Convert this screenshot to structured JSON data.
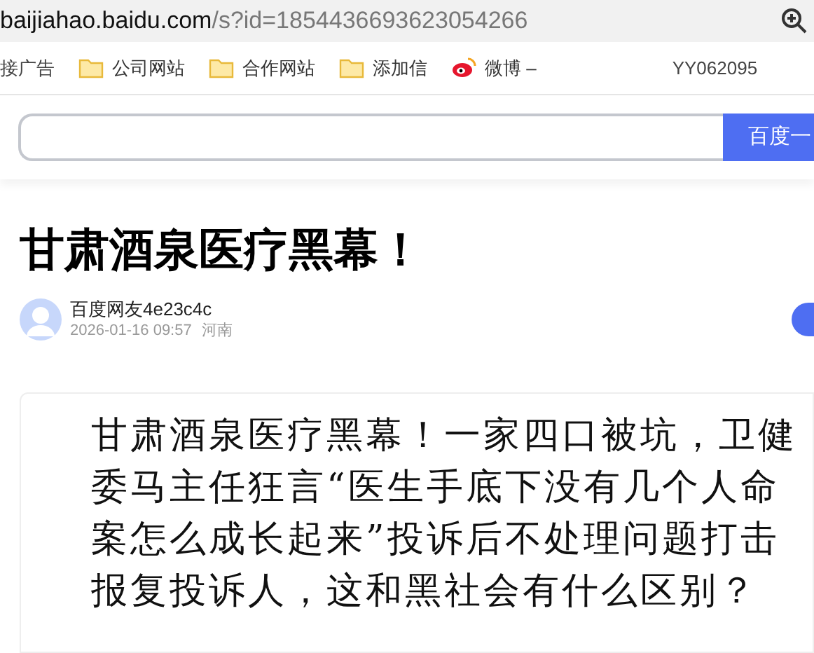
{
  "address_bar": {
    "host": "baijiahao.baidu.com",
    "path": "/s?id=1854436693623054266"
  },
  "bookmarks": [
    {
      "kind": "plain",
      "label": "接广告"
    },
    {
      "kind": "folder",
      "label": "公司网站"
    },
    {
      "kind": "folder",
      "label": "合作网站"
    },
    {
      "kind": "folder",
      "label": "添加信"
    },
    {
      "kind": "weibo",
      "label": "微博 –"
    },
    {
      "kind": "plain",
      "label": "YY062095"
    }
  ],
  "search": {
    "button": "百度一"
  },
  "article": {
    "title": "甘肃酒泉医疗黑幕！",
    "author": "百度网友4e23c4c",
    "time": "2026-01-16 09:57",
    "location": "河南",
    "body": "甘肃酒泉医疗黑幕！一家四口被坑，卫健委马主任狂言“医生手底下没有几个人命案怎么成长起来”投诉后不处理问题打击报复投诉人，这和黑社会有什么区别？"
  }
}
